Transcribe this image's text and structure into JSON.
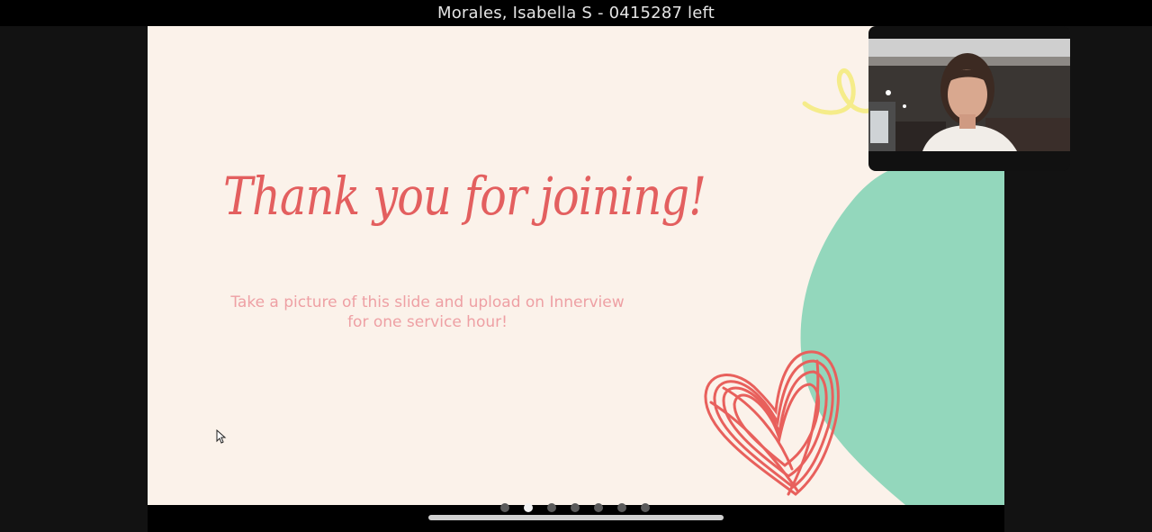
{
  "window": {
    "title": "Morales, Isabella S - 0415287 left"
  },
  "slide": {
    "title": "Thank you for joining!",
    "subtitle": "Take a picture of this slide and upload on Innerview for one service hour!"
  },
  "colors": {
    "slide_bg": "#fbf2ea",
    "title": "#e35f5f",
    "subtitle": "#eea0a4",
    "blob_green": "#93d7bc",
    "heart": "#e8605c",
    "swirl_yellow": "#f5ec8a"
  },
  "pagination": {
    "count": 7,
    "active_index": 1
  },
  "icons": {
    "cursor": "mouse-pointer-icon",
    "heart": "heart-doodle-icon",
    "swirl": "squiggle-icon"
  }
}
